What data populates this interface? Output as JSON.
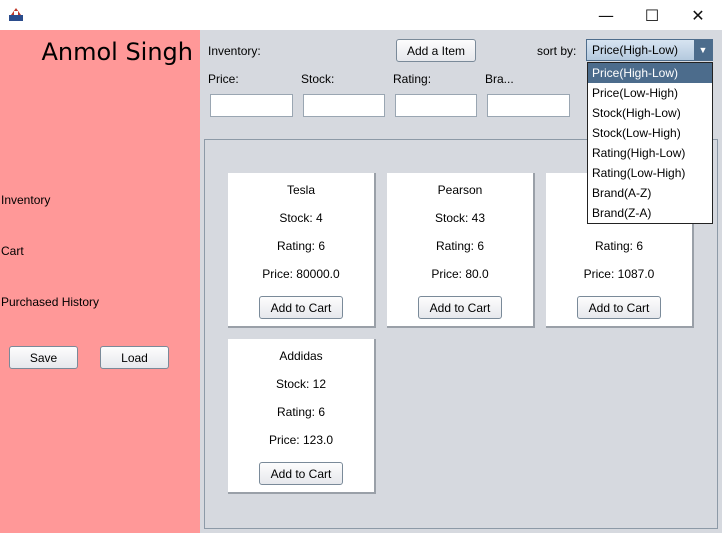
{
  "window": {
    "minimize_glyph": "—",
    "maximize_glyph": "☐",
    "close_glyph": "✕"
  },
  "sidebar": {
    "user_name": "Anmol Singh",
    "nav": [
      {
        "label": "Inventory"
      },
      {
        "label": "Cart"
      },
      {
        "label": "Purchased History"
      }
    ],
    "save_label": "Save",
    "load_label": "Load"
  },
  "toolbar": {
    "inventory_label": "Inventory:",
    "add_item_label": "Add a Item",
    "sort_label": "sort by:",
    "sort_selected": "Price(High-Low)",
    "sort_options": [
      "Price(High-Low)",
      "Price(Low-High)",
      "Stock(High-Low)",
      "Stock(Low-High)",
      "Rating(High-Low)",
      "Rating(Low-High)",
      "Brand(A-Z)",
      "Brand(Z-A)"
    ]
  },
  "filters": [
    {
      "label": "Price:",
      "value": ""
    },
    {
      "label": "Stock:",
      "value": ""
    },
    {
      "label": "Rating:",
      "value": ""
    },
    {
      "label": "Bra...",
      "value": ""
    }
  ],
  "products": [
    {
      "name": "Tesla",
      "stock": "Stock: 4",
      "rating": "Rating: 6",
      "price": "Price: 80000.0",
      "button": "Add to Cart"
    },
    {
      "name": "Pearson",
      "stock": "Stock: 43",
      "rating": "Rating: 6",
      "price": "Price: 80.0",
      "button": "Add to Cart"
    },
    {
      "name": "",
      "stock": "",
      "rating": "Rating: 6",
      "price": "Price: 1087.0",
      "button": "Add to Cart"
    },
    {
      "name": "Addidas",
      "stock": "Stock: 12",
      "rating": "Rating: 6",
      "price": "Price: 123.0",
      "button": "Add to Cart"
    }
  ],
  "colors": {
    "sidebar_bg": "#ff9898",
    "content_bg": "#d6d9df",
    "accent": "#4c6c8c"
  }
}
